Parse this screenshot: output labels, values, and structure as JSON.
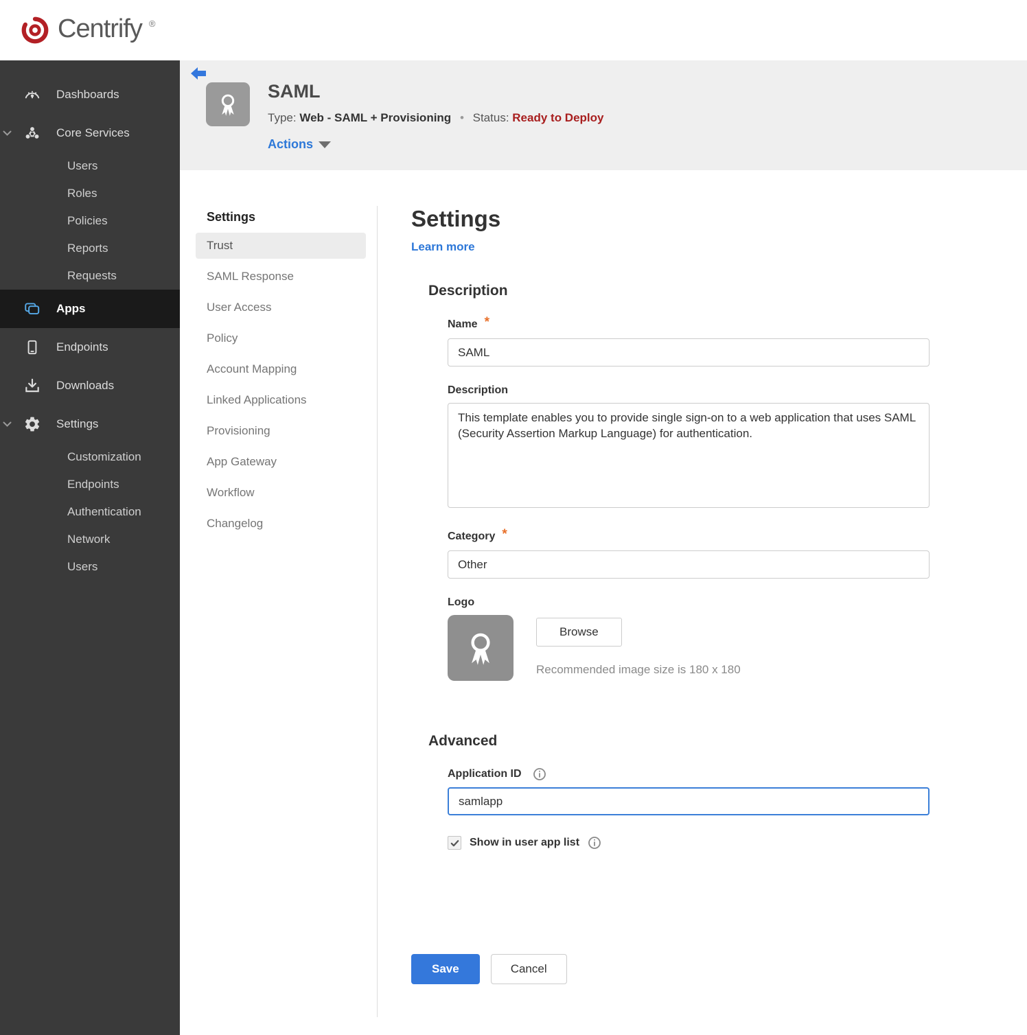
{
  "brand": {
    "name": "Centrify",
    "registered": "®"
  },
  "sidebar": {
    "dashboards": "Dashboards",
    "core_services": "Core Services",
    "core_children": [
      "Users",
      "Roles",
      "Policies",
      "Reports",
      "Requests"
    ],
    "apps": "Apps",
    "endpoints": "Endpoints",
    "downloads": "Downloads",
    "settings": "Settings",
    "settings_children": [
      "Customization",
      "Endpoints",
      "Authentication",
      "Network",
      "Users"
    ]
  },
  "app_header": {
    "title": "SAML",
    "type_label": "Type:",
    "type_value": "Web - SAML + Provisioning",
    "separator": "•",
    "status_label": "Status:",
    "status_value": "Ready to Deploy",
    "actions_label": "Actions"
  },
  "subnav": {
    "heading": "Settings",
    "active_item": "Trust",
    "items": [
      "Trust",
      "SAML Response",
      "User Access",
      "Policy",
      "Account Mapping",
      "Linked Applications",
      "Provisioning",
      "App Gateway",
      "Workflow",
      "Changelog"
    ]
  },
  "main": {
    "title": "Settings",
    "learn_more": "Learn more",
    "description_section": "Description",
    "required_marker": "*",
    "name_label": "Name",
    "name_value": "SAML",
    "description_label": "Description",
    "description_value": "This template enables you to provide single sign-on to a web application that uses SAML (Security Assertion Markup Language) for authentication.",
    "category_label": "Category",
    "category_value": "Other",
    "logo_label": "Logo",
    "browse_button": "Browse",
    "logo_hint": "Recommended image size is 180 x 180",
    "advanced_section": "Advanced",
    "application_id_label": "Application ID",
    "application_id_value": "samlapp",
    "show_in_app_list_label": "Show in user app list",
    "save_button": "Save",
    "cancel_button": "Cancel"
  },
  "colors": {
    "accent_blue": "#2d78d8",
    "save_blue": "#3478db",
    "status_red": "#a81e1e",
    "required_orange": "#e8702a",
    "sidebar_bg": "#3a3a3a",
    "sidebar_active_bg": "#1a1a1a",
    "banner_gray": "#efefef",
    "brand_red": "#b32025"
  }
}
